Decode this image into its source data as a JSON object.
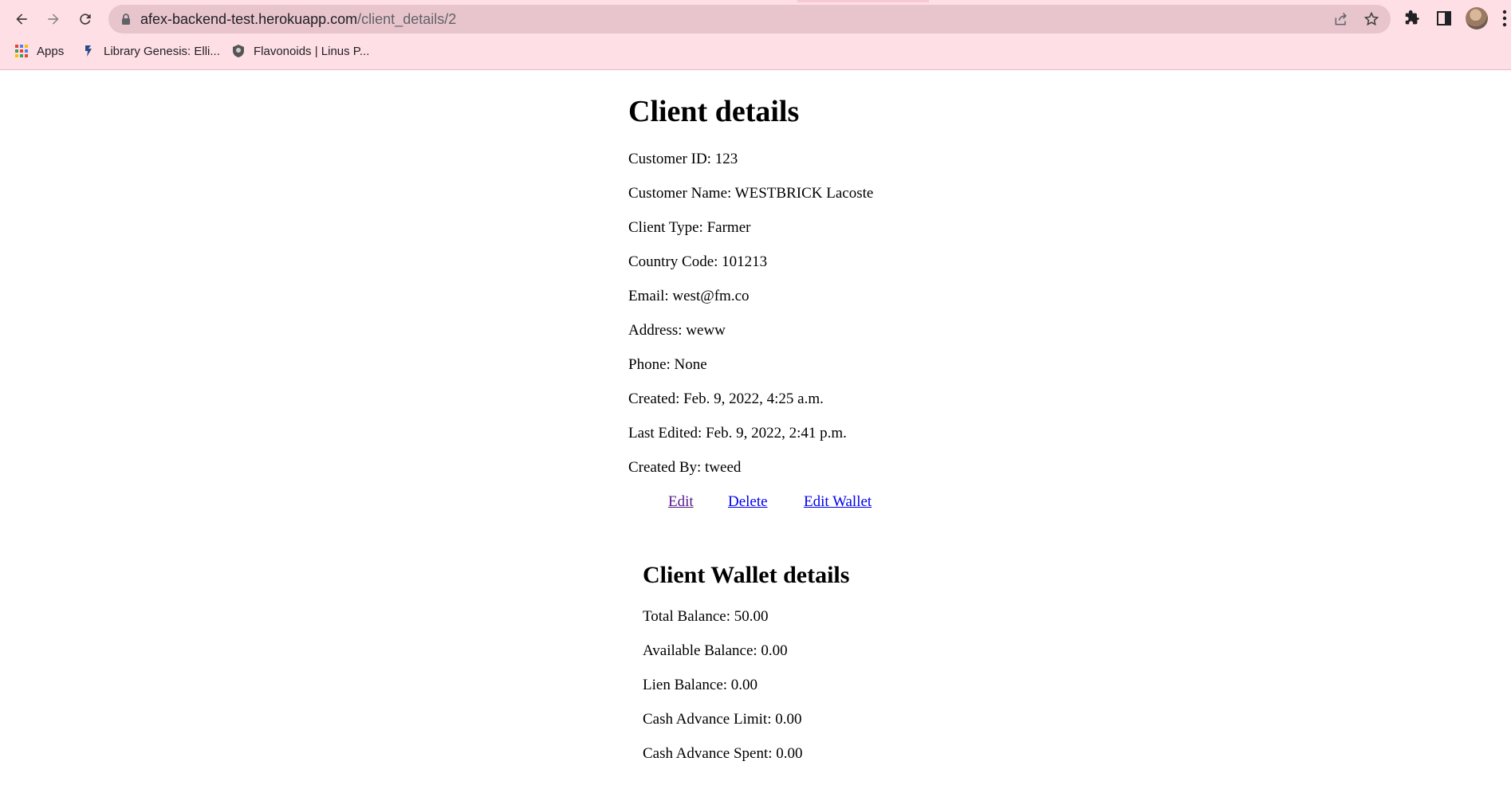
{
  "browser": {
    "url_host": "afex-backend-test.herokuapp.com",
    "url_path": "/client_details/2",
    "bookmarks": [
      {
        "label": "Apps",
        "icon": "apps-grid-icon"
      },
      {
        "label": "Library Genesis: Elli...",
        "icon": "library-genesis-icon"
      },
      {
        "label": "Flavonoids | Linus P...",
        "icon": "linus-pauling-icon"
      }
    ],
    "icons": {
      "back": "back-arrow-icon",
      "forward": "forward-arrow-icon",
      "reload": "reload-icon",
      "lock": "lock-icon",
      "share": "share-icon",
      "star": "star-icon",
      "extensions": "puzzle-icon",
      "side_panel": "side-panel-icon",
      "avatar": "profile-avatar",
      "menu": "kebab-menu-icon"
    },
    "colors": {
      "chrome": "#ffdfe6",
      "omnibox": "#e8c4cd"
    }
  },
  "page": {
    "title": "Client details",
    "fields": [
      "Customer ID: 123",
      "Customer Name: WESTBRICK Lacoste",
      "Client Type: Farmer",
      "Country Code: 101213",
      "Email: west@fm.co",
      "Address: weww",
      "Phone: None",
      "Created: Feb. 9, 2022, 4:25 a.m.",
      "Last Edited: Feb. 9, 2022, 2:41 p.m.",
      "Created By: tweed"
    ],
    "links": {
      "edit": "Edit",
      "delete": "Delete",
      "edit_wallet": "Edit Wallet"
    },
    "wallet": {
      "title": "Client Wallet details",
      "fields": [
        "Total Balance: 50.00",
        "Available Balance: 0.00",
        "Lien Balance: 0.00",
        "Cash Advance Limit: 0.00",
        "Cash Advance Spent: 0.00"
      ]
    }
  }
}
